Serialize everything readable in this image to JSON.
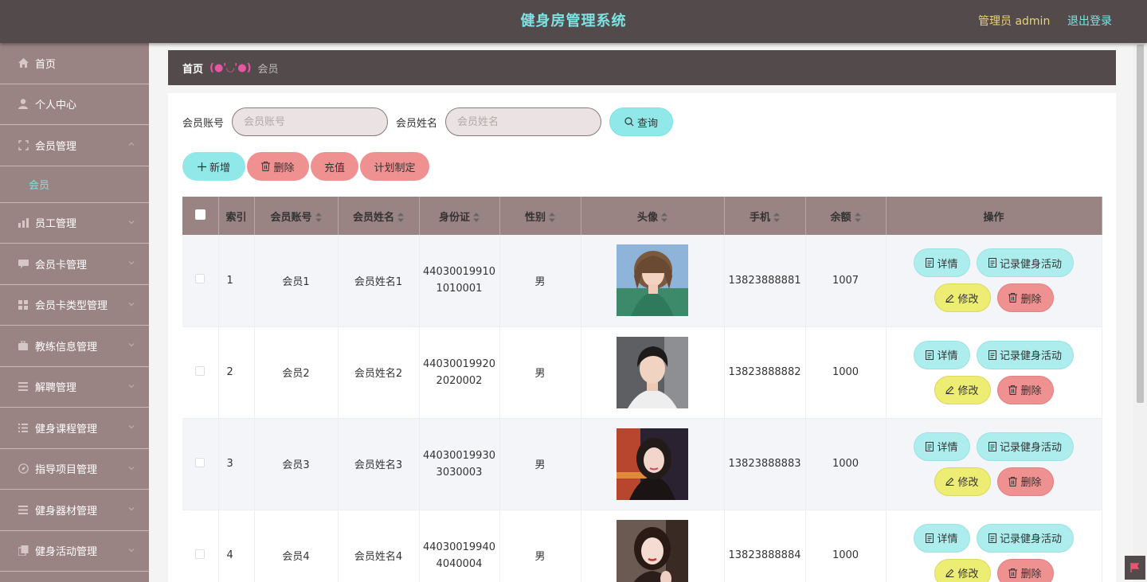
{
  "header": {
    "title": "健身房管理系统",
    "admin_label": "管理员 admin",
    "logout_label": "退出登录"
  },
  "sidebar": {
    "items": [
      {
        "label": "首页",
        "icon": "home-icon"
      },
      {
        "label": "个人中心",
        "icon": "user-icon"
      },
      {
        "label": "会员管理",
        "icon": "expand-icon"
      },
      {
        "label": "员工管理",
        "icon": "chart-icon"
      },
      {
        "label": "会员卡管理",
        "icon": "message-icon"
      },
      {
        "label": "会员卡类型管理",
        "icon": "grid-icon"
      },
      {
        "label": "教练信息管理",
        "icon": "briefcase-icon"
      },
      {
        "label": "解聘管理",
        "icon": "list-icon"
      },
      {
        "label": "健身课程管理",
        "icon": "tasks-icon"
      },
      {
        "label": "指导项目管理",
        "icon": "compass-icon"
      },
      {
        "label": "健身器材管理",
        "icon": "list-icon"
      },
      {
        "label": "健身活动管理",
        "icon": "copy-icon"
      }
    ],
    "subitem": "会员"
  },
  "breadcrumb": {
    "home": "首页",
    "separator": "(●'◡'●)",
    "current": "会员"
  },
  "search": {
    "account_label": "会员账号",
    "account_placeholder": "会员账号",
    "name_label": "会员姓名",
    "name_placeholder": "会员姓名",
    "query_label": "查询"
  },
  "actions": {
    "add": "新增",
    "delete": "删除",
    "recharge": "充值",
    "plan": "计划制定"
  },
  "table": {
    "columns": [
      "索引",
      "会员账号",
      "会员姓名",
      "身份证",
      "性别",
      "头像",
      "手机",
      "余额",
      "操作"
    ],
    "rows": [
      {
        "index": "1",
        "account": "会员1",
        "name": "会员姓名1",
        "id_line1": "44030019910",
        "id_line2": "1010001",
        "gender": "男",
        "phone": "13823888881",
        "balance": "1007"
      },
      {
        "index": "2",
        "account": "会员2",
        "name": "会员姓名2",
        "id_line1": "44030019920",
        "id_line2": "2020002",
        "gender": "男",
        "phone": "13823888882",
        "balance": "1000"
      },
      {
        "index": "3",
        "account": "会员3",
        "name": "会员姓名3",
        "id_line1": "44030019930",
        "id_line2": "3030003",
        "gender": "男",
        "phone": "13823888883",
        "balance": "1000"
      },
      {
        "index": "4",
        "account": "会员4",
        "name": "会员姓名4",
        "id_line1": "44030019940",
        "id_line2": "4040004",
        "gender": "男",
        "phone": "13823888884",
        "balance": "1000"
      }
    ],
    "ops": {
      "detail": "详情",
      "record": "记录健身活动",
      "edit": "修改",
      "delete": "删除"
    }
  },
  "colors": {
    "header_bg": "#534b4b",
    "sidebar_bg": "#9a8383",
    "accent_cyan": "#90e8e8",
    "accent_red": "#ef9191",
    "accent_yellow": "#eded74"
  }
}
